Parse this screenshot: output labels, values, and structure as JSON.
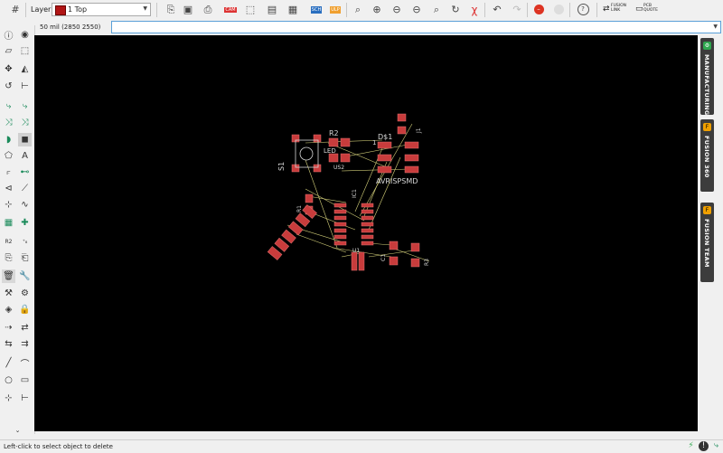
{
  "toolbar": {
    "layer_label": "Layer:",
    "layer_value": "1 Top",
    "layer_color": "#b01515",
    "sch_label": "SCH",
    "fusion_link": "FUSION LINK",
    "pcb_quote": "PCB QUOTE"
  },
  "coords": {
    "text": "50 mil (2850 2550)",
    "command_value": ""
  },
  "panels": {
    "manufacturing": "MANUFACTURING",
    "fusion360": "FUSION 360",
    "fusion_team": "FUSION TEAM",
    "manufacturing_color": "#2fa84f",
    "fusion_color": "#f0a000"
  },
  "board": {
    "labels": {
      "s1": "S1",
      "r2": "R2",
      "led": "LED",
      "us2": "US2",
      "ds1": "D$1",
      "one": "1",
      "avr": "AVRISPSMD",
      "r1": "R1",
      "j1": "J1",
      "c1": "C1",
      "r3": "R3",
      "ic1": "IC1",
      "u1": "U1"
    },
    "pad_color": "#c83c3c",
    "wire_color": "#d4d07a",
    "silk_color": "#d8d8d8"
  },
  "status": {
    "text": "Left-click to select object to delete"
  }
}
